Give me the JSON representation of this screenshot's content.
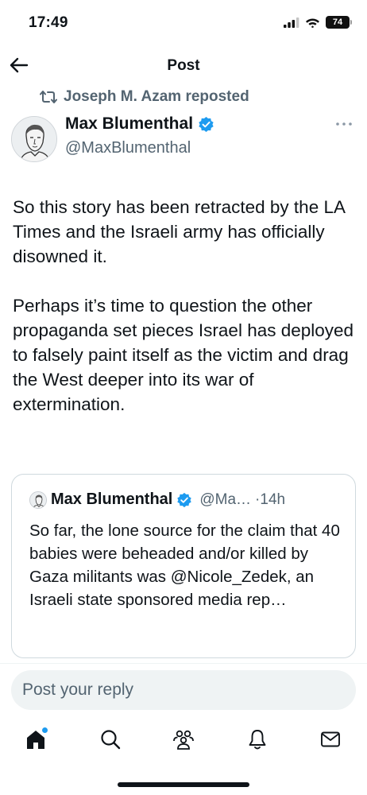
{
  "status_bar": {
    "time": "17:49",
    "battery": "74"
  },
  "nav": {
    "title": "Post",
    "back_icon": "back-arrow-icon"
  },
  "repost": {
    "text": "Joseph M. Azam reposted",
    "icon": "repost-icon"
  },
  "author": {
    "name": "Max Blumenthal",
    "handle": "@MaxBlumenthal",
    "verified": true
  },
  "tweet": {
    "paragraphs": [
      "So this story has been retracted by the LA Times and the Israeli army has officially disowned it.",
      "Perhaps it’s time to question the other propaganda set pieces Israel has deployed to falsely paint itself as the victim and drag the West deeper into its war of extermination."
    ]
  },
  "quote": {
    "name": "Max Blumenthal",
    "handle": "@Ma…",
    "time": "·14h",
    "text": "So far, the lone source for the claim that 40 babies were beheaded and/or killed by Gaza militants was @Nicole_Zedek, an Israeli state sponsored media rep…"
  },
  "reply": {
    "placeholder": "Post your reply"
  },
  "tabs": [
    "home-icon",
    "search-icon",
    "communities-icon",
    "notifications-icon",
    "messages-icon"
  ],
  "colors": {
    "accent": "#1d9bf0",
    "secondary_text": "#536471",
    "text": "#0f1419"
  }
}
